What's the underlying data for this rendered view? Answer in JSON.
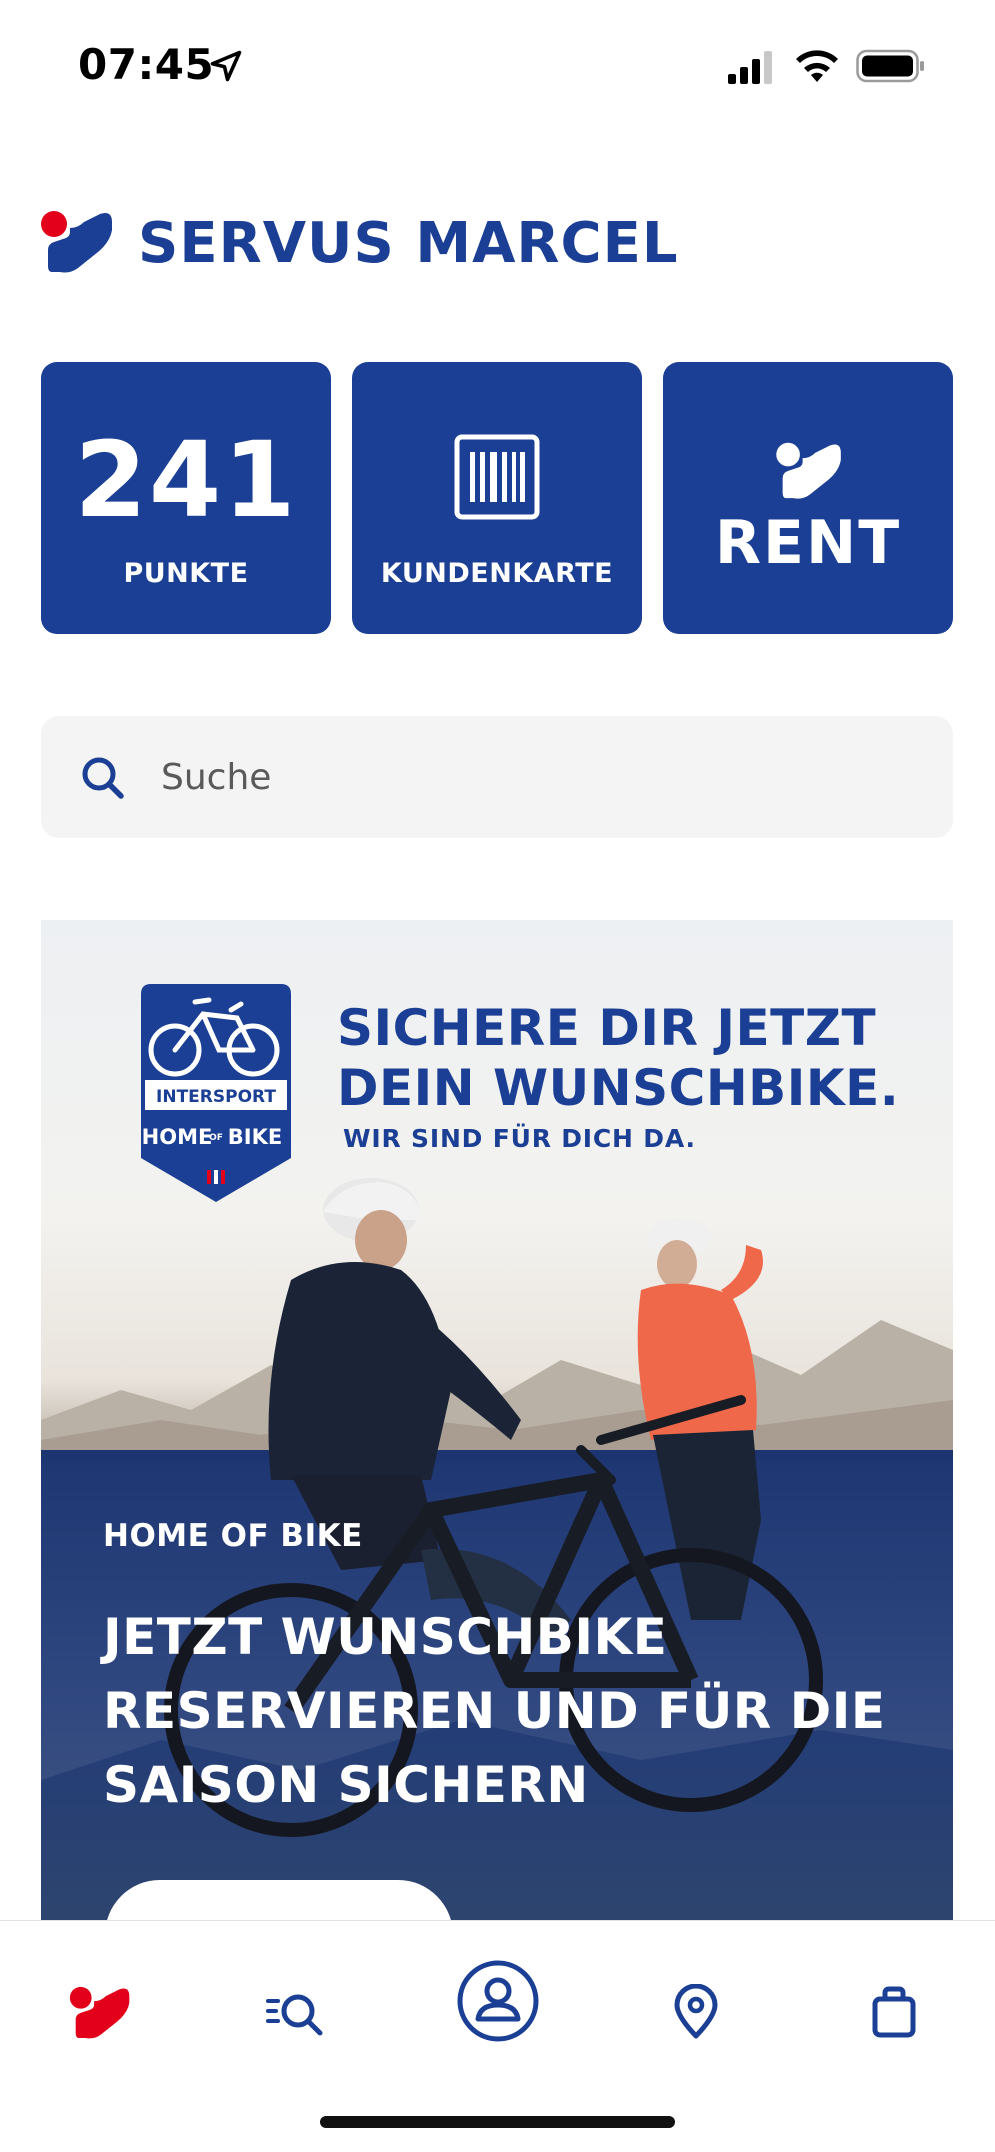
{
  "status_bar": {
    "time": "07:45",
    "icons": [
      "location-arrow-icon",
      "signal-icon",
      "wifi-icon",
      "battery-icon"
    ]
  },
  "header": {
    "logo": "intersport-logo",
    "greeting": "SERVUS MARCEL"
  },
  "tiles": {
    "points": {
      "value": "241",
      "label": "PUNKTE"
    },
    "card": {
      "icon": "barcode-icon",
      "label": "KUNDENKARTE"
    },
    "rent": {
      "icon": "intersport-logo",
      "label": "RENT"
    }
  },
  "search": {
    "placeholder": "Suche",
    "icon": "search-icon"
  },
  "banner": {
    "badge": {
      "brand": "INTERSPORT",
      "home": "HOME",
      "of": "OF",
      "bike": "BIKE"
    },
    "headline_line1": "SICHERE DIR JETZT",
    "headline_line2": "DEIN WUNSCHBIKE.",
    "subline": "WIR SIND FÜR DICH DA.",
    "kicker": "HOME OF BIKE",
    "title_line1": "JETZT WUNSCHBIKE",
    "title_line2": "RESERVIEREN UND FÜR DIE",
    "title_line3": "SAISON SICHERN"
  },
  "bottom_nav": {
    "items": [
      "home-icon",
      "search-list-icon",
      "profile-icon",
      "location-pin-icon",
      "shopping-bag-icon"
    ],
    "active": "home-icon"
  },
  "colors": {
    "brand_blue": "#1b3f94",
    "brand_red": "#e2001a",
    "search_bg": "#f4f4f4",
    "dark_panel": "#142e6e"
  }
}
